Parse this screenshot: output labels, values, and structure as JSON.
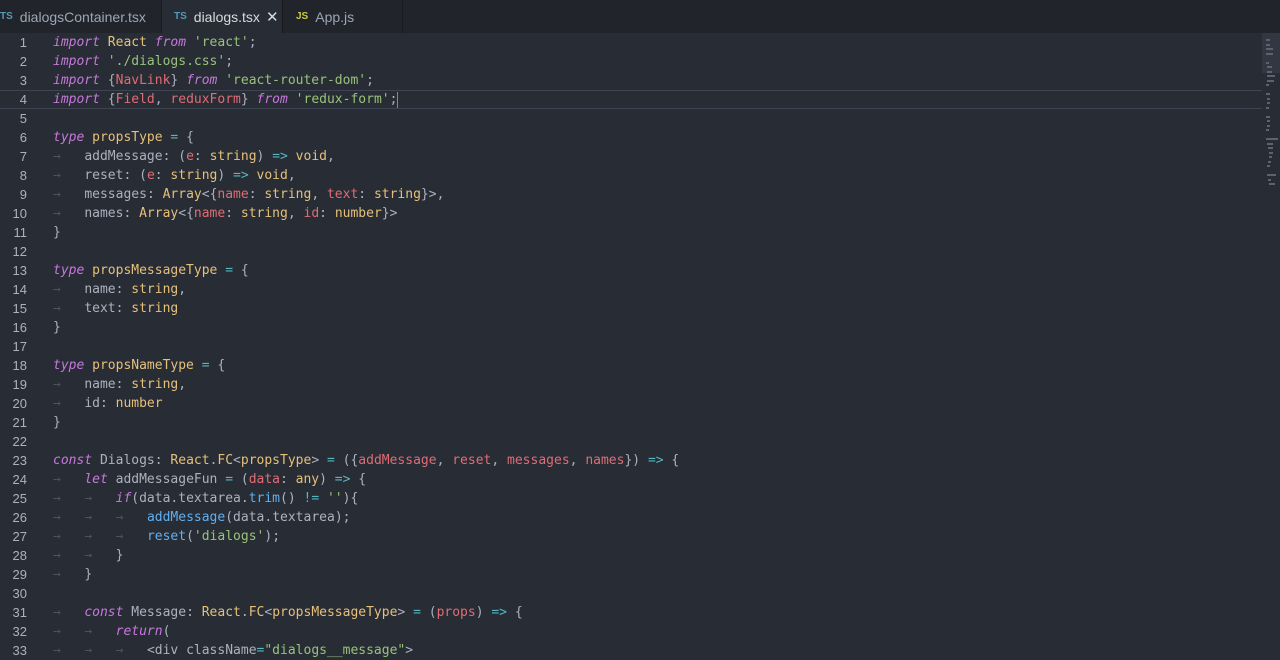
{
  "tabs": [
    {
      "icon": "TS",
      "label": "dialogsContainer.tsx",
      "active": false
    },
    {
      "icon": "TS",
      "label": "dialogs.tsx",
      "active": true,
      "close": "✕"
    },
    {
      "icon": "JS",
      "label": "App.js",
      "active": false
    }
  ],
  "colors": {
    "background": "#282c34",
    "keyword": "#c678dd",
    "string": "#98c379",
    "variable": "#e06c75",
    "type": "#e5c07b",
    "function": "#61afef",
    "operator": "#56b6c2"
  },
  "current_line": 4,
  "lines": [
    {
      "n": "1",
      "t": "import React from 'react';"
    },
    {
      "n": "2",
      "t": "import './dialogs.css';"
    },
    {
      "n": "3",
      "t": "import {NavLink} from 'react-router-dom';"
    },
    {
      "n": "4",
      "t": "import {Field, reduxForm} from 'redux-form';"
    },
    {
      "n": "5",
      "t": ""
    },
    {
      "n": "6",
      "t": "type propsType = {"
    },
    {
      "n": "7",
      "t": "    addMessage: (e: string) => void,"
    },
    {
      "n": "8",
      "t": "    reset: (e: string) => void,"
    },
    {
      "n": "9",
      "t": "    messages: Array<{name: string, text: string}>,"
    },
    {
      "n": "10",
      "t": "    names: Array<{name: string, id: number}>"
    },
    {
      "n": "11",
      "t": "}"
    },
    {
      "n": "12",
      "t": ""
    },
    {
      "n": "13",
      "t": "type propsMessageType = {"
    },
    {
      "n": "14",
      "t": "    name: string,"
    },
    {
      "n": "15",
      "t": "    text: string"
    },
    {
      "n": "16",
      "t": "}"
    },
    {
      "n": "17",
      "t": ""
    },
    {
      "n": "18",
      "t": "type propsNameType = {"
    },
    {
      "n": "19",
      "t": "    name: string,"
    },
    {
      "n": "20",
      "t": "    id: number"
    },
    {
      "n": "21",
      "t": "}"
    },
    {
      "n": "22",
      "t": ""
    },
    {
      "n": "23",
      "t": "const Dialogs: React.FC<propsType> = ({addMessage, reset, messages, names}) => {"
    },
    {
      "n": "24",
      "t": "    let addMessageFun = (data: any) => {"
    },
    {
      "n": "25",
      "t": "        if(data.textarea.trim() != ''){"
    },
    {
      "n": "26",
      "t": "            addMessage(data.textarea);"
    },
    {
      "n": "27",
      "t": "            reset('dialogs');"
    },
    {
      "n": "28",
      "t": "        }"
    },
    {
      "n": "29",
      "t": "    }"
    },
    {
      "n": "30",
      "t": ""
    },
    {
      "n": "31",
      "t": "    const Message: React.FC<propsMessageType> = (props) => {"
    },
    {
      "n": "32",
      "t": "        return("
    },
    {
      "n": "33",
      "t": "            <div className=\"dialogs__message\">"
    }
  ]
}
